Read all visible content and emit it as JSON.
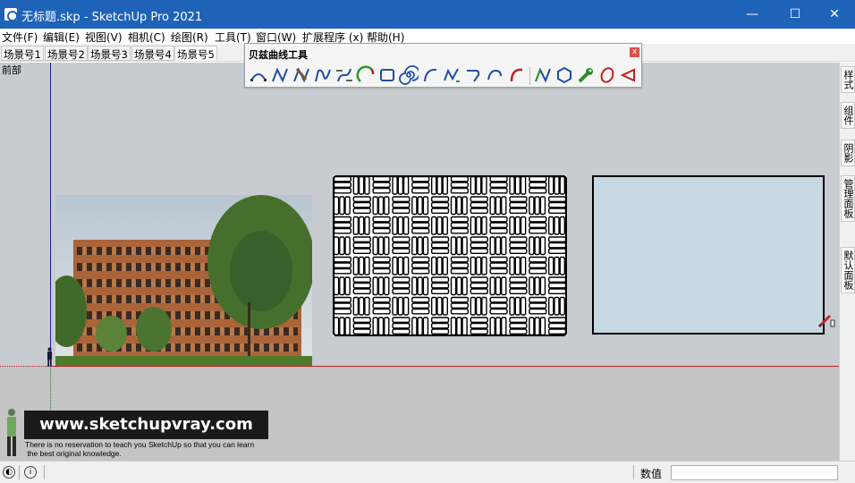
{
  "window": {
    "title": "无标题.skp - SketchUp Pro 2021",
    "minimize_glyph": "—",
    "maximize_glyph": "☐",
    "close_glyph": "✕"
  },
  "menu": [
    "文件(F)",
    "编辑(E)",
    "视图(V)",
    "相机(C)",
    "绘图(R)",
    "工具(T)",
    "窗口(W)",
    "扩展程序 (x)",
    "帮助(H)"
  ],
  "scenes": {
    "tabs": [
      "场景号1",
      "场景号2",
      "场景号3",
      "场景号4",
      "场景号5"
    ],
    "active_index": 4
  },
  "viewport": {
    "view_label": "前部",
    "background_color": "#c8ccd0",
    "ground_color": "#c4c4c4",
    "panel_fill": "#c6d8e2"
  },
  "bezier_toolbar": {
    "title": "贝兹曲线工具",
    "close_glyph": "x",
    "icons": [
      "bezier-arc-icon",
      "bezier-curve-icon",
      "bezier-brush-icon",
      "polyline-n-icon",
      "spline-icon",
      "arc-green-icon",
      "rectangle-icon",
      "spiral-icon",
      "arc-icon",
      "wave-icon",
      "curve-up-icon",
      "curve-down-icon",
      "arc-red-icon",
      "polyline-icon",
      "polygon-icon",
      "wrench-icon",
      "ellipse-icon",
      "triangle-arrow-icon"
    ]
  },
  "right_tray": [
    "样式",
    "组件",
    "阴影",
    "管理面板",
    "默认面板"
  ],
  "watermark": {
    "url_text": "www.sketchupvray.com",
    "caption_line1": "There is no reservation to teach you SketchUp so that you can learn",
    "caption_line2": " the best original knowledge."
  },
  "statusbar": {
    "measurements_label": "数值",
    "measurements_value": "",
    "info_glyph": "i"
  }
}
